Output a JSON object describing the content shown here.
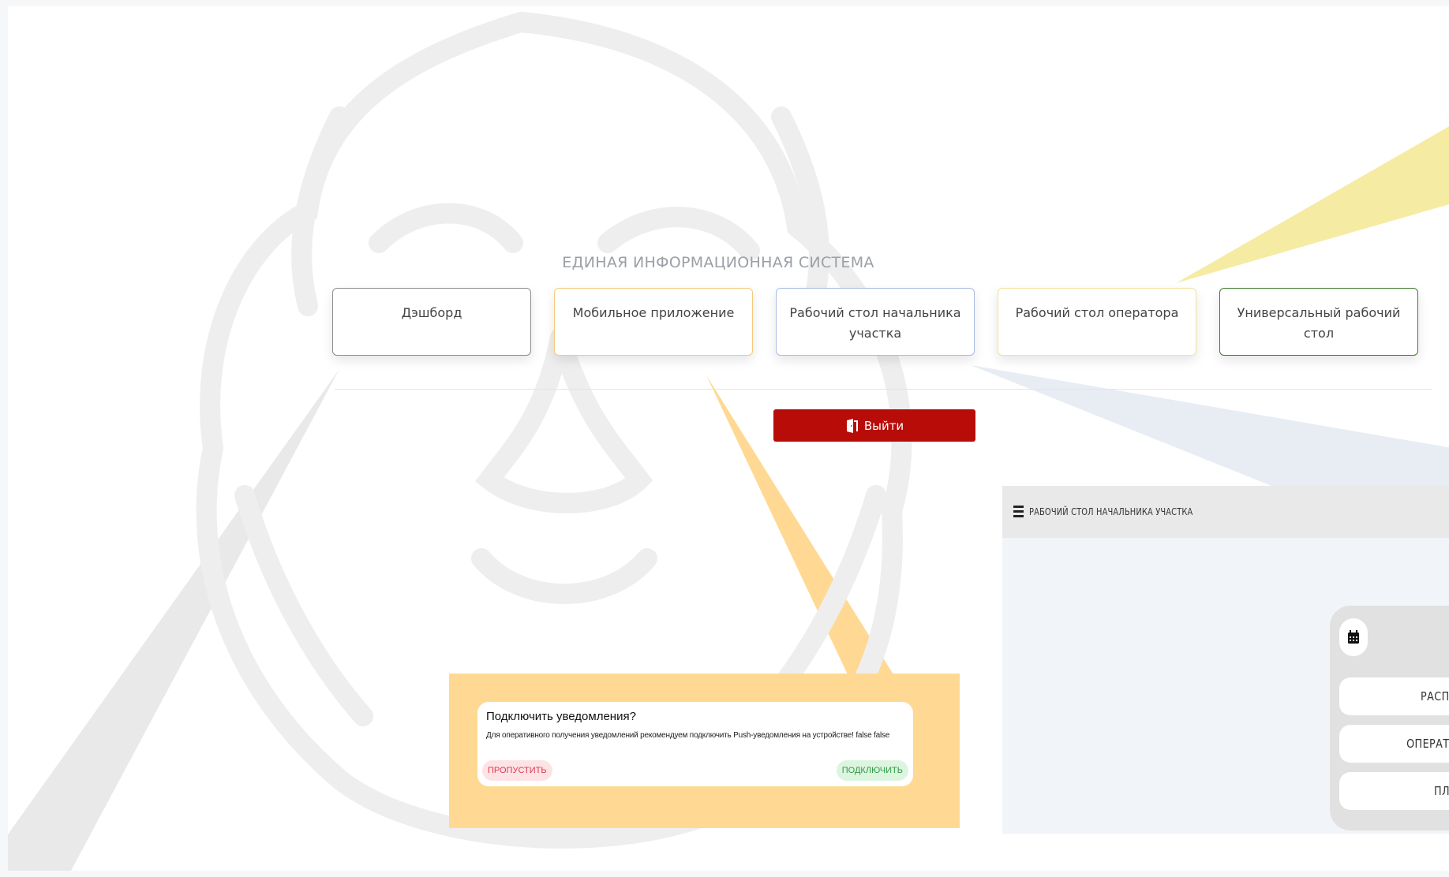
{
  "header": {
    "system_title": "ЕДИНАЯ ИНФОРМАЦИОННАЯ СИСТЕМА"
  },
  "cards": [
    {
      "label": "Дэшборд"
    },
    {
      "label": "Мобильное приложение"
    },
    {
      "label": "Рабочий стол начальника участка"
    },
    {
      "label": "Рабочий стол оператора"
    },
    {
      "label": "Универсальный рабочий стол"
    }
  ],
  "logout": {
    "label": "Выйти",
    "icon": "door-exit-icon"
  },
  "notification": {
    "title": "Подключить уведомления?",
    "text": "Для оперативного получения уведомлений рекомендуем подключить Push-уведомления на устройстве! false false",
    "skip_label": "ПРОПУСТИТЬ",
    "connect_label": "ПОДКЛЮЧИТЬ"
  },
  "preview": {
    "title": "РАБОЧИЙ СТОЛ НАЧАЛЬНИКА УЧАСТКА",
    "menu_icon": "hamburger-menu-icon",
    "calendar_icon": "calendar-icon",
    "buttons": [
      {
        "label": "РАСПИСАНИ"
      },
      {
        "label": "ОПЕРАТИВНОЕ"
      },
      {
        "label": "ПЛАНИРО"
      }
    ]
  },
  "colors": {
    "logout_bg": "#b80c09",
    "popup_frame": "#ffd993",
    "skip_text": "#e0374d",
    "connect_text": "#2f9a44"
  }
}
